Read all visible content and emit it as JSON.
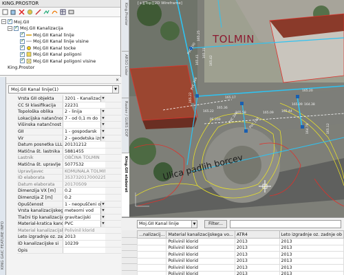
{
  "panel": {
    "title": "KING.PROSTOR",
    "tree": [
      {
        "label": "Moj.GII",
        "indent": 0,
        "expander": "−",
        "checked": true,
        "icon": "none"
      },
      {
        "label": "Moj.GII Kanalizacija",
        "indent": 1,
        "expander": "−",
        "checked": true,
        "icon": "none"
      },
      {
        "label": "Moj.GII Kanal linije",
        "indent": 2,
        "expander": "",
        "checked": true,
        "icon": "line-icon"
      },
      {
        "label": "Moj.GII Kanal linije visine",
        "indent": 2,
        "expander": "",
        "checked": true,
        "icon": "line-height-icon"
      },
      {
        "label": "Moj.GII Kanal tocke",
        "indent": 2,
        "expander": "",
        "checked": true,
        "icon": "point-icon"
      },
      {
        "label": "Moj.GII Kanal poligoni",
        "indent": 2,
        "expander": "",
        "checked": true,
        "icon": "polygon-icon"
      },
      {
        "label": "Moj.GII Kanal poligoni visine",
        "indent": 2,
        "expander": "",
        "checked": true,
        "icon": "polygon-height-icon"
      },
      {
        "label": "King.Prostor",
        "indent": 0,
        "expander": "",
        "checked": false,
        "icon": "none"
      }
    ],
    "side_tab": "KING GAIC FEATURE INFO",
    "close_label": "×",
    "layer_select": "Moj.GII Kanal linije(1)",
    "properties": [
      {
        "label": "Vrsta GII objekta",
        "value": "3201 - Kanalizacij",
        "dropdown": true,
        "dim": false
      },
      {
        "label": "CC SI klasifikacija",
        "value": "22231",
        "dropdown": false,
        "dim": false
      },
      {
        "label": "Topološka oblika",
        "value": "2 - linija",
        "dropdown": true,
        "dim": false
      },
      {
        "label": "Lokacijska natančnos",
        "value": "7 - od 0,1 m do",
        "dropdown": true,
        "dim": false
      },
      {
        "label": "Višinska natančnost",
        "value": "",
        "dropdown": true,
        "dim": false
      },
      {
        "label": "GII",
        "value": "1 - gospodarsk",
        "dropdown": true,
        "dim": false
      },
      {
        "label": "Vir",
        "value": "2 - geodetska izr",
        "dropdown": true,
        "dim": false
      },
      {
        "label": "Datum posnetka LLL",
        "value": "20131212",
        "dropdown": false,
        "dim": false
      },
      {
        "label": "Matična št. lastnika",
        "value": "5881455",
        "dropdown": false,
        "dim": false
      },
      {
        "label": "Lastnik",
        "value": "OBČINA TOLMIN",
        "dropdown": false,
        "dim": true
      },
      {
        "label": "Matična št. upravlje",
        "value": "5077532",
        "dropdown": false,
        "dim": false
      },
      {
        "label": "Upravljavec",
        "value": "KOMUNALA TOLMIN",
        "dropdown": false,
        "dim": true
      },
      {
        "label": "ID elaborata",
        "value": "3537320170002256",
        "dropdown": false,
        "dim": true
      },
      {
        "label": "Datum elaborata",
        "value": "20170509",
        "dropdown": false,
        "dim": true
      },
      {
        "label": "Dimenzija VX [m]",
        "value": "0.2",
        "dropdown": false,
        "dim": false
      },
      {
        "label": "Dimenzija Z [m]",
        "value": "0.2",
        "dropdown": false,
        "dim": false
      },
      {
        "label": "Opuščenost",
        "value": "1 - neopuščeni o",
        "dropdown": true,
        "dim": false
      },
      {
        "label": "Vrsta kanalizacijskega",
        "value": "meteorni vod",
        "dropdown": true,
        "dim": false
      },
      {
        "label": "Tlačni tip kanalizacije",
        "value": "gravitacijski",
        "dropdown": true,
        "dim": false
      },
      {
        "label": "Material-kratica kanc",
        "value": "PVC",
        "dropdown": true,
        "dim": false
      },
      {
        "label": "Material kanalizacijsk",
        "value": "Polivinil klorid",
        "dropdown": false,
        "dim": true
      },
      {
        "label": "Leto izgradnje oz. zad",
        "value": "2013",
        "dropdown": false,
        "dim": false
      },
      {
        "label": "ID kanalizacijske si",
        "value": "10239",
        "dropdown": false,
        "dim": false
      },
      {
        "label": "Opis",
        "value": "",
        "dropdown": false,
        "dim": false
      }
    ]
  },
  "map": {
    "viewport_label": "[+][Top][2D Wireframe]",
    "vertical_tabs": [
      "King.Prostor",
      "ARSO Lidar",
      "Raster / GURS DOF",
      "King.GII elaborat"
    ],
    "active_tab": "King.GII elaborat",
    "town_label": "TOLMIN",
    "street_label": "Ulica padlih borcev",
    "small_labels": [
      "PVC 250",
      "PVC 300",
      "PE 200",
      "PVC 200",
      "PVC 150",
      "165.31",
      "165.41",
      "165.42",
      "165.17",
      "165.36",
      "165.22",
      "165.58",
      "165.09",
      "165.44",
      "165.20",
      "164.38",
      "164.78",
      "165.12",
      "165.22",
      "165.25",
      "165.09"
    ]
  },
  "table": {
    "layer": "Moj.GII Kanal linije",
    "filter_label": "Filter...",
    "columns": [
      "...nalizacij...",
      "Material kanalizacijskega vo...",
      "ATR4",
      "Leto izgradnje oz. zadnje ob"
    ],
    "rows": [
      [
        "",
        "Polivinil klorid",
        "2013",
        "2013"
      ],
      [
        "",
        "Polivinil klorid",
        "2013",
        "2013"
      ],
      [
        "",
        "Polivinil klorid",
        "2013",
        "2013"
      ],
      [
        "",
        "Polivinil klorid",
        "2013",
        "2013"
      ],
      [
        "",
        "Polivinil klorid",
        "2013",
        "2013"
      ],
      [
        "",
        "Polivinil klorid",
        "2013",
        "2013"
      ]
    ]
  }
}
